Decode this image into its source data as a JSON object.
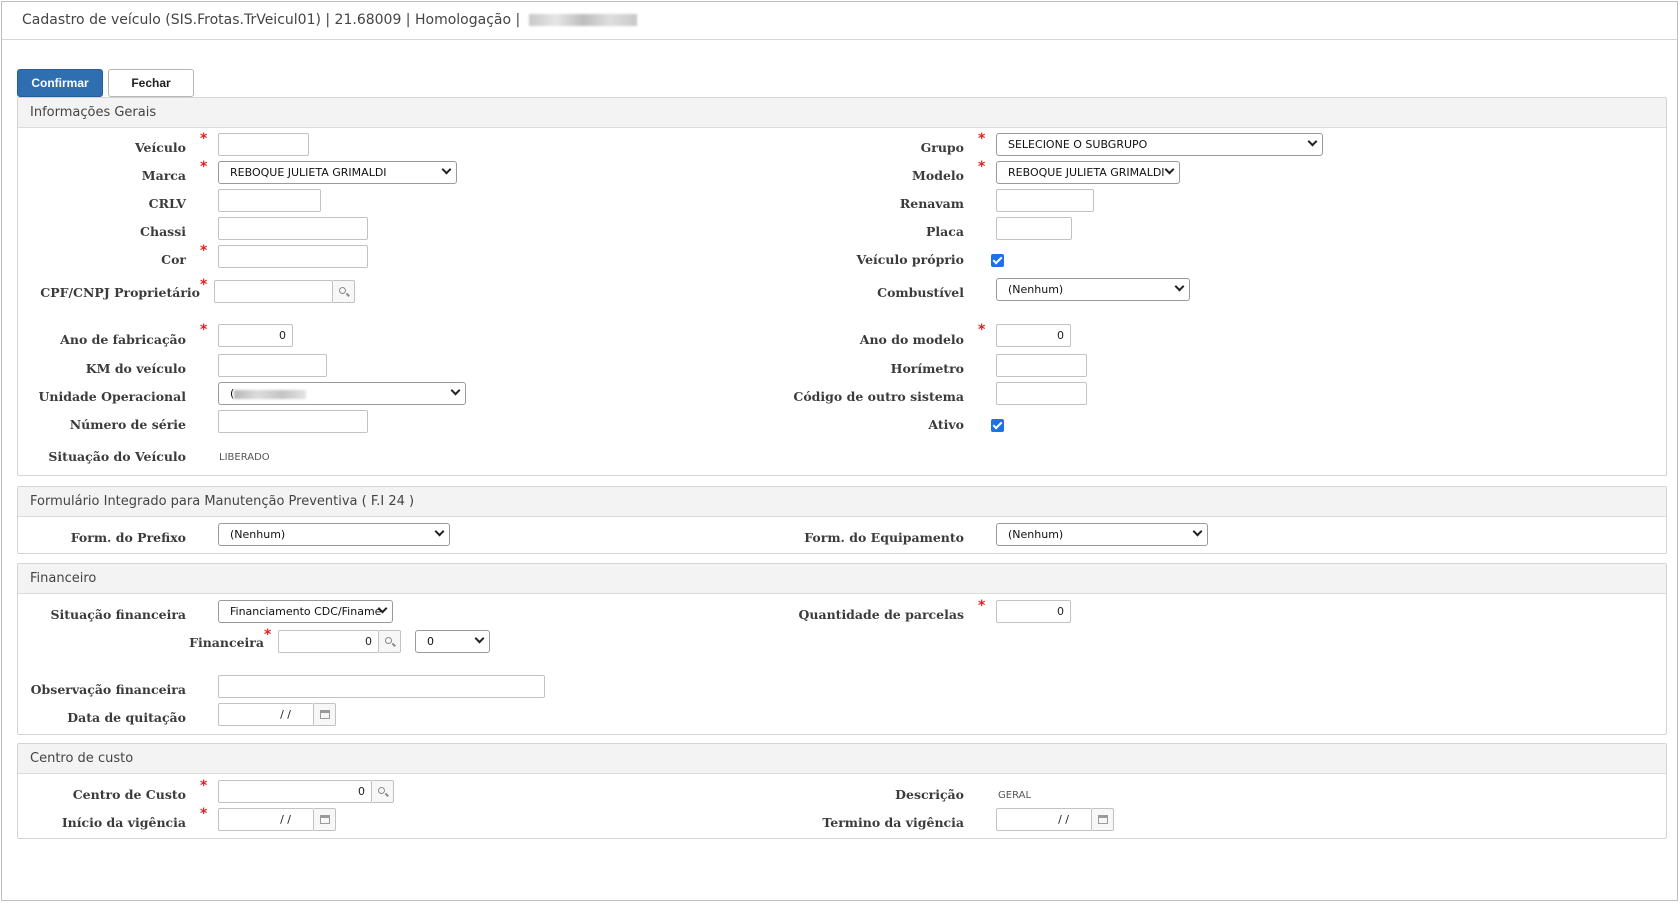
{
  "window": {
    "title": "Cadastro de veículo (SIS.Frotas.TrVeicul01) | 21.68009 | Homologação |"
  },
  "toolbar": {
    "confirm_label": "Confirmar",
    "close_label": "Fechar"
  },
  "geral": {
    "section_title": "Informações Gerais",
    "veiculo_label": "Veículo",
    "grupo_label": "Grupo",
    "grupo_value": "SELECIONE O SUBGRUPO",
    "marca_label": "Marca",
    "marca_value": "REBOQUE JULIETA GRIMALDI",
    "modelo_label": "Modelo",
    "modelo_value": "REBOQUE JULIETA GRIMALDI",
    "crlv_label": "CRLV",
    "renavam_label": "Renavam",
    "chassi_label": "Chassi",
    "placa_label": "Placa",
    "cor_label": "Cor",
    "proprio_label": "Veículo próprio",
    "cpf_label": "CPF/CNPJ Proprietário",
    "combustivel_label": "Combustível",
    "combustivel_value": "(Nenhum)",
    "ano_fab_label": "Ano de fabricação",
    "ano_fab_value": "0",
    "ano_modelo_label": "Ano do modelo",
    "ano_modelo_value": "0",
    "km_label": "KM do veículo",
    "horimetro_label": "Horímetro",
    "unidade_label": "Unidade Operacional",
    "unidade_value_prefix": "(",
    "codigo_label": "Código de outro sistema",
    "serie_label": "Número de série",
    "ativo_label": "Ativo",
    "situacao_label": "Situação do Veículo",
    "situacao_value": "LIBERADO"
  },
  "fi24": {
    "section_title": "Formulário Integrado para Manutenção Preventiva ( F.I 24 )",
    "prefixo_label": "Form. do Prefixo",
    "prefixo_value": "(Nenhum)",
    "equip_label": "Form. do Equipamento",
    "equip_value": "(Nenhum)"
  },
  "financeiro": {
    "section_title": "Financeiro",
    "situacao_label": "Situação financeira",
    "situacao_value": "Financiamento CDC/Finame",
    "parcelas_label": "Quantidade de parcelas",
    "parcelas_value": "0",
    "financeira_label": "Financeira",
    "financeira_value": "0",
    "financeira_select_value": "0",
    "obs_label": "Observação financeira",
    "quitacao_label": "Data de quitação",
    "quitacao_value": "/ /"
  },
  "custo": {
    "section_title": "Centro de custo",
    "centro_label": "Centro de Custo",
    "centro_value": "0",
    "descricao_label": "Descrição",
    "descricao_value": "GERAL",
    "inicio_label": "Início da vigência",
    "inicio_value": "/ /",
    "termino_label": "Termino da vigência",
    "termino_value": "/ /"
  }
}
